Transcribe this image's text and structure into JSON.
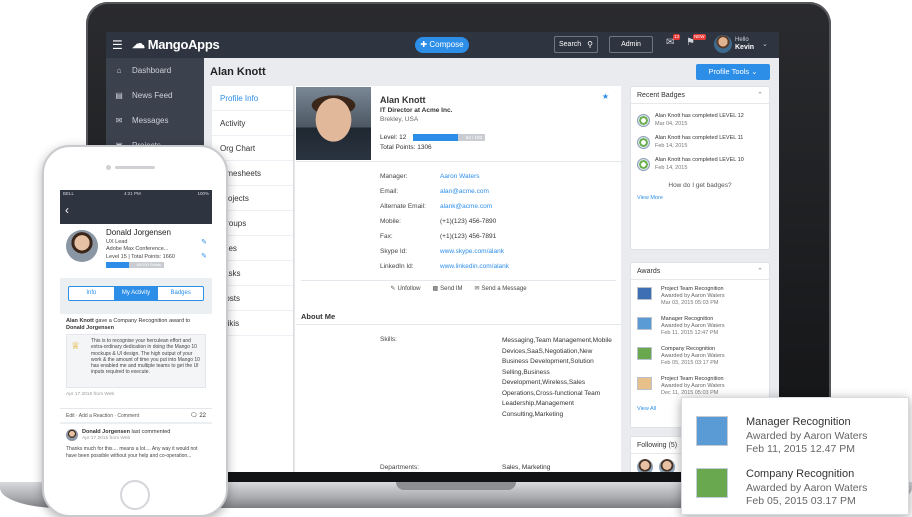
{
  "app": {
    "name": "MangoApps"
  },
  "topbar": {
    "compose_label": "Compose",
    "search_label": "Search",
    "admin_label": "Admin",
    "messages_count": "13",
    "notif_badge": "NEW",
    "hello_label": "Hello",
    "user_name": "Kevin"
  },
  "sidebar": {
    "items": [
      {
        "label": "Dashboard",
        "icon": "home-icon"
      },
      {
        "label": "News Feed",
        "icon": "inbox-icon"
      },
      {
        "label": "Messages",
        "icon": "mail-icon"
      },
      {
        "label": "Projects",
        "icon": "briefcase-icon"
      }
    ]
  },
  "page": {
    "title": "Alan Knott",
    "profile_tools_label": "Profile Tools"
  },
  "subnav": {
    "items": [
      "Profile Info",
      "Activity",
      "Org Chart",
      "Timesheets",
      "Projects",
      "Groups",
      "Files",
      "Tasks",
      "Posts",
      "Wikis"
    ]
  },
  "profile": {
    "name": "Alan Knott",
    "role": "IT Director at Acme Inc.",
    "location": "Brekley, USA",
    "level_label": "Level: 12",
    "level_progress_text": "62 / 100",
    "level_progress": 0.62,
    "points_label": "Total Points: 1306",
    "fields": [
      {
        "key": "Manager:",
        "value": "Aaron Waters",
        "link": true
      },
      {
        "key": "Email:",
        "value": "alan@acme.com",
        "link": true
      },
      {
        "key": "Alternate Email:",
        "value": "alank@acme.com",
        "link": true
      },
      {
        "key": "Mobile:",
        "value": "(+1)(123) 456-7890",
        "link": false
      },
      {
        "key": "Fax:",
        "value": "(+1)(123) 456-7891",
        "link": false
      },
      {
        "key": "Skype Id:",
        "value": "www.skype.com/alank",
        "link": true
      },
      {
        "key": "LinkedIn Id:",
        "value": "www.linkedin.com/alank",
        "link": true
      }
    ],
    "actions": {
      "unfollow": "Unfollow",
      "send_im": "Send IM",
      "send_message": "Send a Message"
    },
    "about_heading": "About Me",
    "skills_label": "Skills:",
    "skills_value": "Messaging,Team Management,Mobile Devices,SaaS,Negotiation,New Business Development,Solution Selling,Business Development,Wireless,Sales Operations,Cross-functional Team Leadership,Management Consulting,Marketing",
    "departments_label": "Departments:",
    "departments_value": "Sales, Marketing"
  },
  "recent_badges": {
    "title": "Recent Badges",
    "items": [
      {
        "text": "Alan Knott has completed LEVEL 12",
        "date": "Mar 04, 2015"
      },
      {
        "text": "Alan Knott has completed LEVEL 11",
        "date": "Feb 14, 2015"
      },
      {
        "text": "Alan Knott has completed LEVEL 10",
        "date": "Feb 14, 2015"
      }
    ],
    "how_text": "How do I get badges?",
    "view_more": "View More"
  },
  "awards": {
    "title": "Awards",
    "items": [
      {
        "title": "Project Team Recognition",
        "by": "Awarded by Aaron Waters",
        "date": "Mar 03, 2015 05:03 PM",
        "color": "#3e6fb5"
      },
      {
        "title": "Manager Recognition",
        "by": "Awarded by Aaron Waters",
        "date": "Feb 11, 2015 12:47 PM",
        "color": "#5b9bd5"
      },
      {
        "title": "Company Recognition",
        "by": "Awarded by Aaron Waters",
        "date": "Feb 05, 2015 03:17 PM",
        "color": "#6aa84f"
      },
      {
        "title": "Project Team Recognition",
        "by": "Awarded by Aaron Waters",
        "date": "Dec 11, 2015 05:03 PM",
        "color": "#e8c08a"
      }
    ],
    "view_all": "View All"
  },
  "following": {
    "title": "Following",
    "count": "(5)"
  },
  "popup": {
    "items": [
      {
        "title": "Manager Recognition",
        "by": "Awarded by Aaron Waters",
        "date": "Feb 11, 2015 12.47 PM",
        "color": "#5b9bd5"
      },
      {
        "title": "Company Recognition",
        "by": "Awarded by Aaron Waters",
        "date": "Feb 05, 2015 03.17 PM",
        "color": "#6aa84f"
      }
    ]
  },
  "phone": {
    "status_left": "BELL",
    "status_time": "4:21 PM",
    "status_right": "100%",
    "name": "Donald Jorgensen",
    "role": "UX Lead",
    "conference": "Adobe Max Conference...",
    "level_line": "Level 15 | Total Points: 1660",
    "progress_text": "40/100 Points",
    "progress": 0.4,
    "tabs": [
      "Info",
      "My Activity",
      "Badges"
    ],
    "feed1": {
      "actor": "Alan Knott",
      "action": " gave a Company Recognition award to ",
      "target": "Donald Jorgensen",
      "body": "This is to recognise your herculean effort and extra-ordinary dedication in doing the Mango 10 mockups & UI design. The high output of your work & the amount of time you put into Mango 10 has enabled me and multiple teams to get the UI inputs required to execute.",
      "time": "Apr 17 2015 from Web"
    },
    "feed_actions": "Edit · Add a Reaction · Comment",
    "comment_count": "22",
    "feed2": {
      "name": "Donald Jorgensen",
      "action": " last commented",
      "time": "Apr 17 2015 from Web",
      "body": "Thanks much for this.... means a lot.... Any way it would not have been possible without your help and co-operation..."
    }
  }
}
